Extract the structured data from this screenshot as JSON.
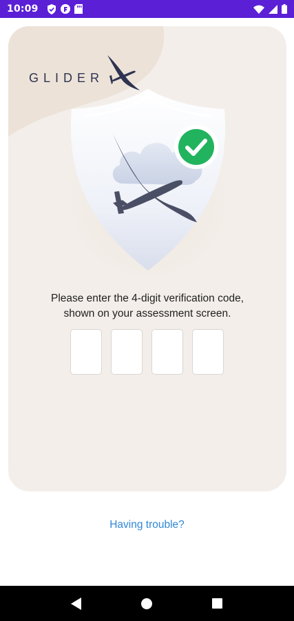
{
  "status_bar": {
    "time": "10:09",
    "left_icons": [
      "shield-icon",
      "badge-icon",
      "sd-card-icon"
    ],
    "right_icons": [
      "wifi-icon",
      "signal-icon",
      "battery-icon"
    ],
    "background": "#5b1fd6"
  },
  "brand": {
    "name": "GLIDER",
    "color": "#2e3350"
  },
  "illustration": {
    "icons": [
      "shield-icon",
      "cloud-icon",
      "glider-plane-icon",
      "check-circle-icon"
    ],
    "check_color": "#22b35e"
  },
  "verification": {
    "instruction_line1": "Please enter the 4-digit verification code,",
    "instruction_line2": "shown on your assessment screen.",
    "digits": [
      "",
      "",
      "",
      ""
    ]
  },
  "help": {
    "trouble_label": "Having trouble?",
    "link_color": "#2f86d6"
  },
  "nav_bar": {
    "buttons": [
      "back-icon",
      "home-icon",
      "recents-icon"
    ]
  }
}
